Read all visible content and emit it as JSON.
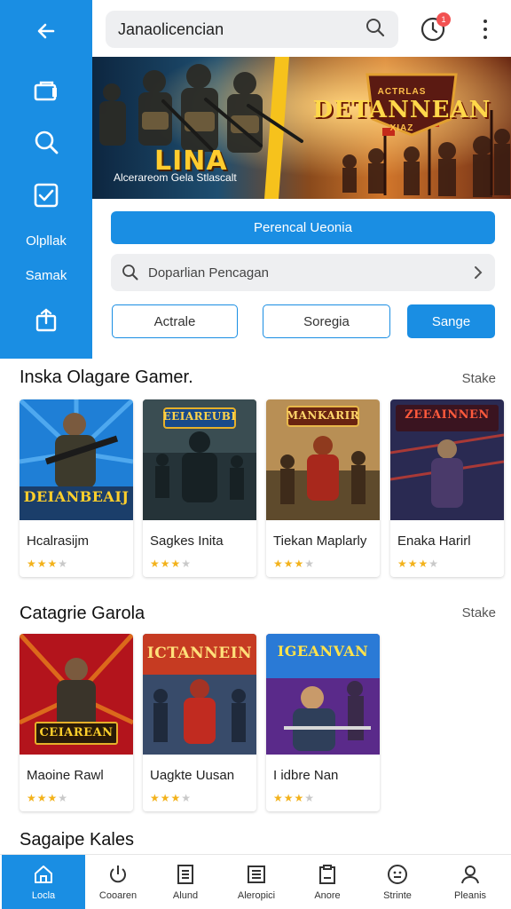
{
  "sidebar": {
    "back_icon": "arrow-left-icon",
    "items": [
      {
        "icon": "folder-icon"
      },
      {
        "icon": "search-icon"
      },
      {
        "icon": "checkbox-icon"
      },
      {
        "label": "Olpllak"
      },
      {
        "label": "Samak"
      },
      {
        "icon": "share-icon"
      }
    ]
  },
  "header": {
    "search_value": "Janaolicencian",
    "notification_count": "1"
  },
  "hero": {
    "title": "LINA",
    "subtitle": "Alcerareom Gela Stlascalt",
    "emblem_small": "ACTRLAS",
    "emblem_big": "DETANNEAN",
    "emblem_tag": "XIAZ"
  },
  "actions": {
    "primary_label": "Perencal Ueonia",
    "search_placeholder": "Doparlian Pencagan",
    "filters": [
      "Actrale",
      "Soregia",
      "Sange"
    ]
  },
  "sections": [
    {
      "title": "Inska Olagare Gamer.",
      "more": "Stake",
      "games": [
        {
          "name": "Hcalrasijm",
          "art": "DEIANBEAIJ",
          "rating": 3
        },
        {
          "name": "Sagkes Inita",
          "art": "EEIAREUBI",
          "rating": 3
        },
        {
          "name": "Tiekan Maplarly",
          "art": "MANKARIR",
          "rating": 3
        },
        {
          "name": "Enaka Harirl",
          "art": "ZEEAINNEN",
          "rating": 3
        }
      ]
    },
    {
      "title": "Catagrie Garola",
      "more": "Stake",
      "games": [
        {
          "name": "Maoine Rawl",
          "art": "CEIAREAN",
          "rating": 3
        },
        {
          "name": "Uagkte Uusan",
          "art": "ICTANNEIN",
          "rating": 3
        },
        {
          "name": "I idbre Nan",
          "art": "IGEANVAN",
          "rating": 3
        }
      ]
    },
    {
      "title": "Sagaipe Kales"
    }
  ],
  "bottom_nav": [
    {
      "label": "Locla",
      "icon": "home-icon",
      "active": true
    },
    {
      "label": "Cooaren",
      "icon": "power-icon"
    },
    {
      "label": "Alund",
      "icon": "document-icon"
    },
    {
      "label": "Aleropici",
      "icon": "list-icon"
    },
    {
      "label": "Anore",
      "icon": "clipboard-icon"
    },
    {
      "label": "Strinte",
      "icon": "face-icon"
    },
    {
      "label": "Pleanis",
      "icon": "person-icon"
    }
  ],
  "colors": {
    "accent": "#1a8ee3",
    "star": "#f3b21b",
    "badge": "#f25151"
  }
}
